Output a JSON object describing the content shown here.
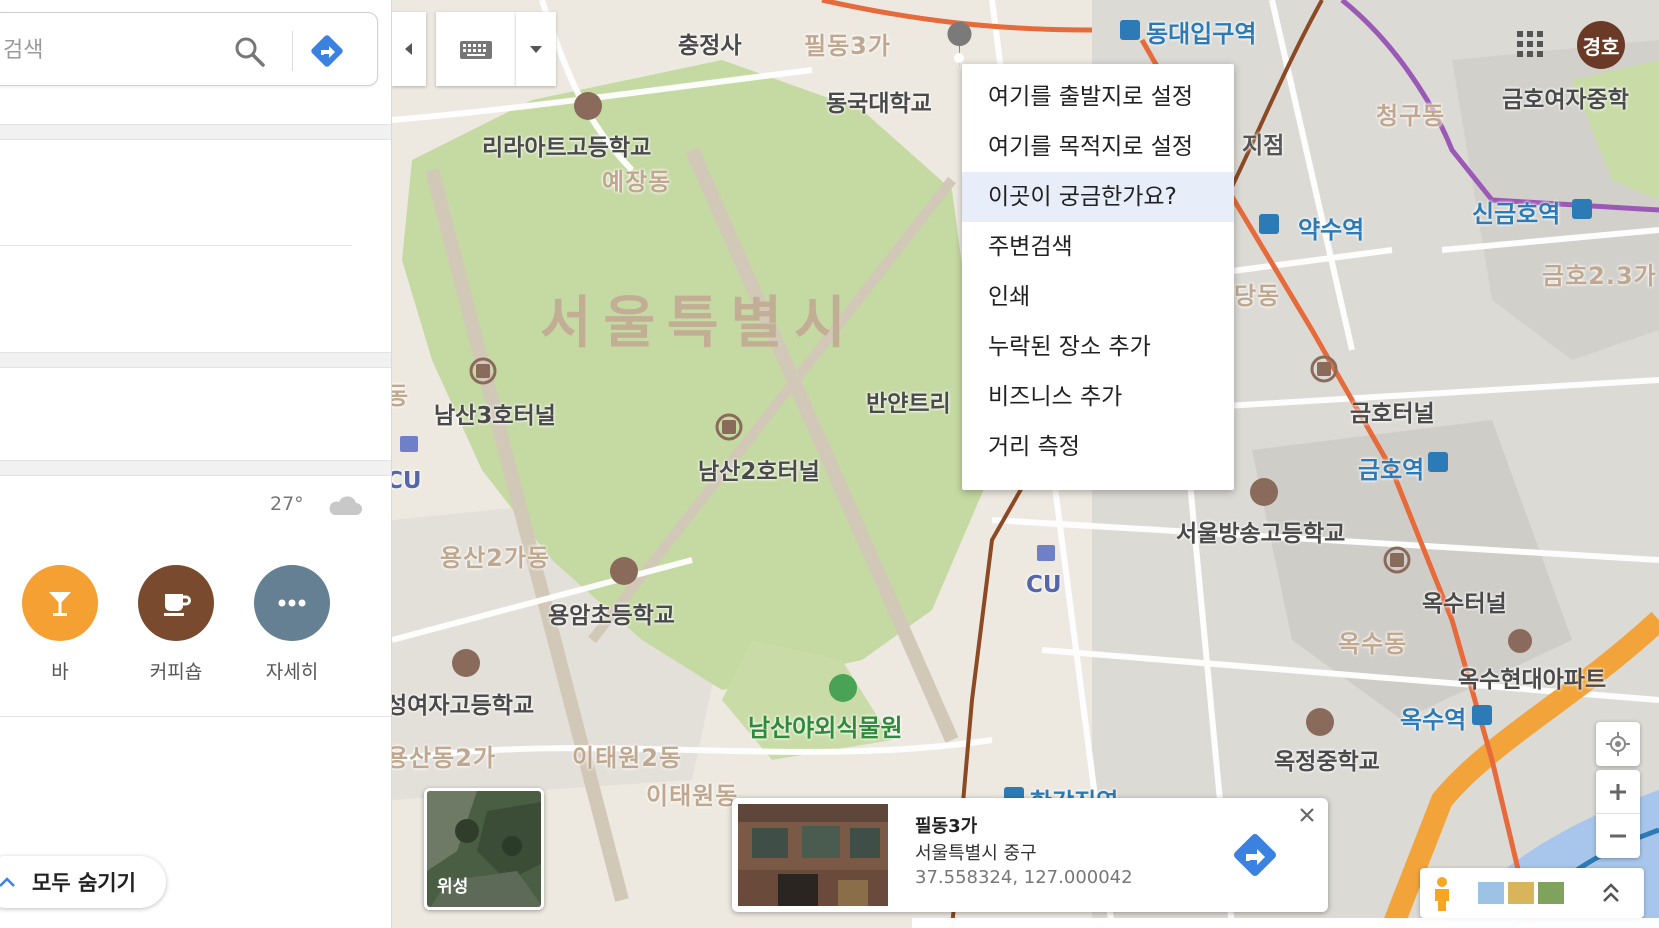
{
  "search": {
    "placeholder": "검색"
  },
  "weather": {
    "temperature": "27°"
  },
  "categories": [
    {
      "label": "바",
      "icon": "cocktail-icon",
      "color": "#f5a033"
    },
    {
      "label": "커피숍",
      "icon": "coffee-cup-icon",
      "color": "#7a4a2e"
    },
    {
      "label": "자세히",
      "icon": "more-dots-icon",
      "color": "#657f93"
    }
  ],
  "hide_all": {
    "label": "모두 숨기기"
  },
  "user": {
    "avatar_text": "경호"
  },
  "context_menu": {
    "items": [
      "여기를 출발지로 설정",
      "여기를 목적지로 설정",
      "이곳이 궁금한가요?",
      "주변검색",
      "인쇄",
      "누락된 장소 추가",
      "비즈니스 추가",
      "거리 측정"
    ],
    "highlighted": "이곳이 궁금한가요?"
  },
  "satellite": {
    "label": "위성"
  },
  "place_card": {
    "name": "필동3가",
    "address": "서울특별시 중구",
    "coordinates": "37.558324, 127.000042"
  },
  "map_labels": {
    "chungjeongsa": "충정사",
    "pildong3ga_map": "필동3가",
    "dongdaeipgu": "동대입구역",
    "dongguk_univ": "동국대학교",
    "liraat_school": "리라아트고등학교",
    "yejangdong": "예장동",
    "seoul": "서울특별시",
    "namsan3": "남산3호터널",
    "namsan2": "남산2호터널",
    "banyantree": "반얀트리",
    "cu1": "CU",
    "cu2": "CU",
    "yongsan2gadong": "용산2가동",
    "yongam_school": "용암초등학교",
    "botanical": "남산야외식물원",
    "girls_high": "성여자고등학교",
    "yongsandong2ga": "용산동2가",
    "itaewon2dong": "이태원2동",
    "itaewondong": "이태원동",
    "hangangjin": "한강진역",
    "cheonggudong": "청구동",
    "geumho_girls": "금호여자중학",
    "yaksu": "약수역",
    "sinkeumho": "신금호역",
    "geumho237": "금호2.3가",
    "dangdong": "당동",
    "geumho_tunnel": "금호터널",
    "geumho_station": "금호역",
    "broadcast_school": "서울방송고등학교",
    "oksu_tunnel": "옥수터널",
    "oksudong": "옥수동",
    "oksu_hyundai": "옥수현대아파트",
    "oksu_station": "옥수역",
    "okjeong_school": "옥정중학교",
    "dong_left": "동",
    "jeom": "지점"
  }
}
